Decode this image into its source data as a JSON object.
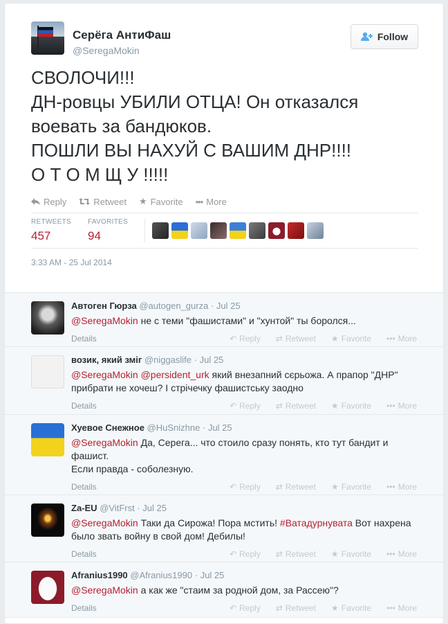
{
  "author": {
    "name": "Серёга АнтиФаш",
    "handle": "@SeregaMokin"
  },
  "follow_label": "Follow",
  "tweet_lines": [
    "СВОЛОЧИ!!!",
    "ДН-ровцы УБИЛИ ОТЦА! Он отказался",
    "воевать за бандюков.",
    "ПОШЛИ ВЫ НАХУЙ С ВАШИМ ДНР!!!!",
    "О Т О М Щ У !!!!!"
  ],
  "actions": {
    "reply": "Reply",
    "retweet": "Retweet",
    "favorite": "Favorite",
    "more": "More"
  },
  "stats": {
    "retweets_label": "RETWEETS",
    "retweets": "457",
    "favorites_label": "FAVORITES",
    "favorites": "94"
  },
  "timestamp": "3:33 AM - 25 Jul 2014",
  "reply_actions": {
    "details": "Details",
    "reply": "Reply",
    "retweet": "Retweet",
    "favorite": "Favorite",
    "more": "More"
  },
  "replies": [
    {
      "name": "Автоген Гюрза",
      "handle": "@autogen_gurza",
      "date": "Jul 25",
      "mentions": "@SeregaMokin",
      "text": " не с теми \"фашистами\" и \"хунтой\" ты боролся..."
    },
    {
      "name": "возик, який зміг",
      "handle": "@niggaslife",
      "date": "Jul 25",
      "mentions": "@SeregaMokin @persident_urk",
      "text": " який внезапний сєрьожа. А прапор \"ДНР\" прибрати не хочеш? І стрічечку фашистську заодно"
    },
    {
      "name": "Хуевое Снежное",
      "handle": "@HuSnizhne",
      "date": "Jul 25",
      "mentions": "@SeregaMokin",
      "text": " Да, Серега... что стоило сразу понять, кто тут бандит и фашист.",
      "text2": "Если правда - соболезную."
    },
    {
      "name": "Za-EU",
      "handle": "@VitFrst",
      "date": "Jul 25",
      "mentions": "@SeregaMokin",
      "text": " Таки да Сирожа! Пора мстить! ",
      "hashtag": "#Ватадурнувата",
      "text_after": " Вот нахрена было звать войну в свой дом! Дебилы!"
    },
    {
      "name": "Afranius1990",
      "handle": "@Afranius1990",
      "date": "Jul 25",
      "mentions": "@SeregaMokin",
      "text": " а как же \"стаим за родной дом, за Рассею\"?"
    }
  ]
}
